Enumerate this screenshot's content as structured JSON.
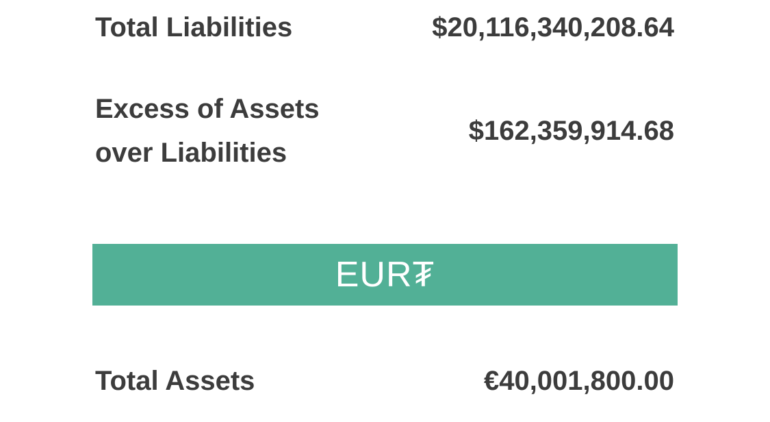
{
  "colors": {
    "banner_background": "#52b096",
    "banner_text": "#ffffff",
    "text": "#3c3c3c"
  },
  "summary_usd": {
    "total_liabilities_label": "Total Liabilities",
    "total_liabilities_value": "$20,116,340,208.64",
    "excess_label": "Excess of Assets over Liabilities",
    "excess_value": "$162,359,914.68"
  },
  "currency_section": {
    "title": "EUR₮"
  },
  "summary_eur": {
    "total_assets_label": "Total Assets",
    "total_assets_value": "€40,001,800.00"
  }
}
